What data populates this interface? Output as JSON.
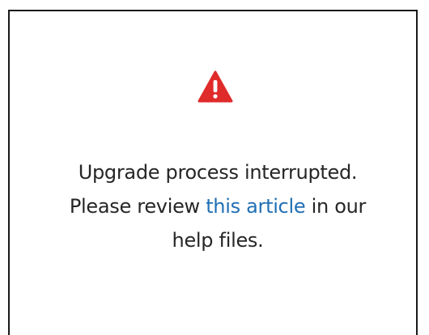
{
  "dialog": {
    "icon": "warning-icon",
    "icon_color": "#e02b2b",
    "link_color": "#1f6fb5",
    "message": {
      "line1": "Upgrade process interrupted.",
      "line2_before": "Please review ",
      "link_text": "this article",
      "line2_after": " in our",
      "line3": "help files."
    }
  }
}
